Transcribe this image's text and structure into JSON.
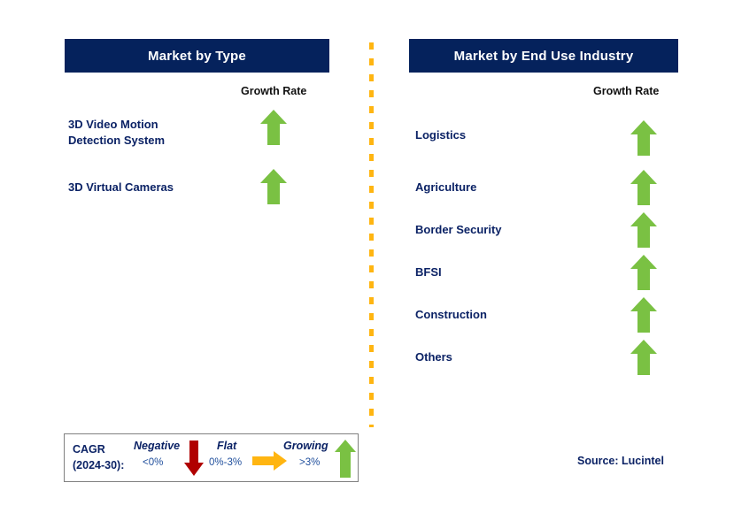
{
  "colors": {
    "header_bg": "#05225c",
    "header_text": "#ffffff",
    "label_text": "#0b2265",
    "arrow_growing": "#7ac143",
    "arrow_negative": "#b00000",
    "arrow_flat": "#ffb511",
    "divider": "#ffb511",
    "legend_border": "#808080"
  },
  "columns": {
    "left": {
      "title": "Market by Type",
      "growth_caption": "Growth Rate",
      "rows": [
        {
          "label": "3D Video Motion\nDetection System",
          "trend": "growing",
          "trend_icon": "arrow-up-icon"
        },
        {
          "label": "3D Virtual Cameras",
          "trend": "growing",
          "trend_icon": "arrow-up-icon"
        }
      ]
    },
    "right": {
      "title": "Market by End Use Industry",
      "growth_caption": "Growth Rate",
      "rows": [
        {
          "label": "Logistics",
          "trend": "growing",
          "trend_icon": "arrow-up-icon"
        },
        {
          "label": "Agriculture",
          "trend": "growing",
          "trend_icon": "arrow-up-icon"
        },
        {
          "label": "Border Security",
          "trend": "growing",
          "trend_icon": "arrow-up-icon"
        },
        {
          "label": "BFSI",
          "trend": "growing",
          "trend_icon": "arrow-up-icon"
        },
        {
          "label": "Construction",
          "trend": "growing",
          "trend_icon": "arrow-up-icon"
        },
        {
          "label": "Others",
          "trend": "growing",
          "trend_icon": "arrow-up-icon"
        }
      ]
    }
  },
  "legend": {
    "cagr_label": "CAGR\n(2024-30):",
    "entries": [
      {
        "title": "Negative",
        "value": "<0%",
        "icon": "arrow-down-icon"
      },
      {
        "title": "Flat",
        "value": "0%-3%",
        "icon": "arrow-right-icon"
      },
      {
        "title": "Growing",
        "value": ">3%",
        "icon": "arrow-up-icon"
      }
    ]
  },
  "source": "Source: Lucintel"
}
